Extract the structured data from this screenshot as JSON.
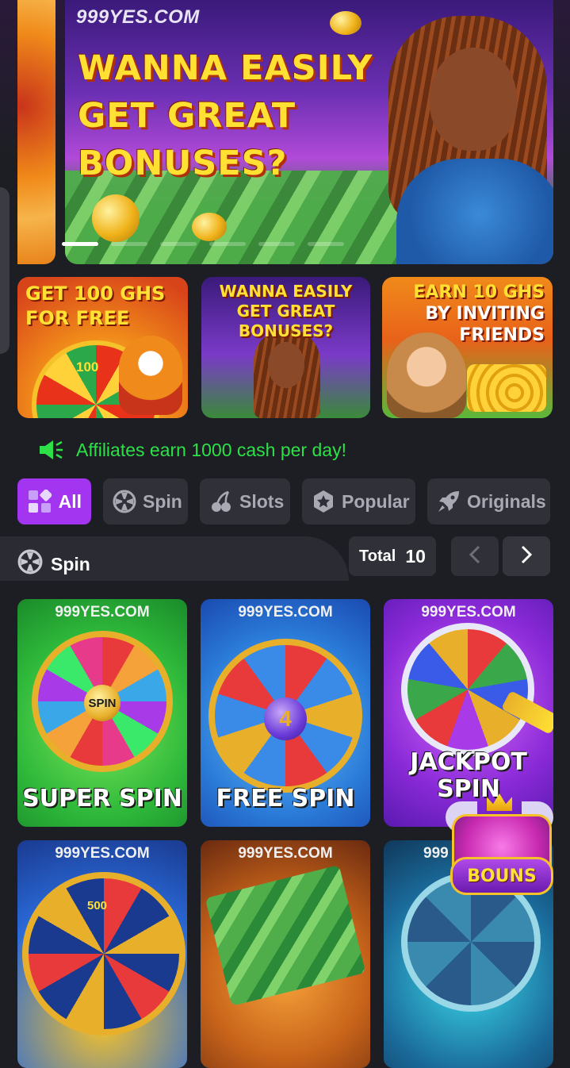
{
  "banner": {
    "brand": "999YES.COM",
    "headline_1": "WANNA EASILY",
    "headline_2": "GET GREAT",
    "headline_3": "BONUSES?",
    "dots": [
      true,
      false,
      false,
      false,
      false,
      false
    ]
  },
  "promos": [
    {
      "line1": "GET 100 GHS",
      "line2": "FOR FREE",
      "badge": "100"
    },
    {
      "line1": "WANNA EASILY",
      "line2": "GET GREAT BONUSES?"
    },
    {
      "line1": "EARN 10 GHS",
      "line2": "BY INVITING",
      "line3": "FRIENDS"
    }
  ],
  "marquee": {
    "text": "Affiliates earn 1000 cash per day!",
    "icon": "speaker-icon",
    "color": "#2ee048"
  },
  "tabs": [
    {
      "label": "All",
      "icon": "grid-icon",
      "active": true
    },
    {
      "label": "Spin",
      "icon": "wheel-icon",
      "active": false
    },
    {
      "label": "Slots",
      "icon": "cherry-icon",
      "active": false
    },
    {
      "label": "Popular",
      "icon": "star-badge-icon",
      "active": false
    },
    {
      "label": "Originals",
      "icon": "rocket-icon",
      "active": false
    }
  ],
  "section": {
    "title": "Spin",
    "icon": "wheel-icon",
    "total_label": "Total",
    "total_value": "10"
  },
  "games": [
    {
      "brand": "999YES.COM",
      "name": "SUPER SPIN",
      "hub": "SPIN"
    },
    {
      "brand": "999YES.COM",
      "name": "FREE SPIN",
      "hub": "4"
    },
    {
      "brand": "999YES.COM",
      "name": "JACKPOT SPIN"
    },
    {
      "brand": "999YES.COM",
      "hub": "500"
    },
    {
      "brand": "999YES.COM"
    },
    {
      "brand": "999"
    }
  ],
  "floating": {
    "label": "BOUNS",
    "icon": "treasure-chest-icon"
  },
  "colors": {
    "accent": "#a334f0",
    "background": "#1d1e24",
    "tab_bg": "#2f3038",
    "marquee": "#2ee048"
  }
}
